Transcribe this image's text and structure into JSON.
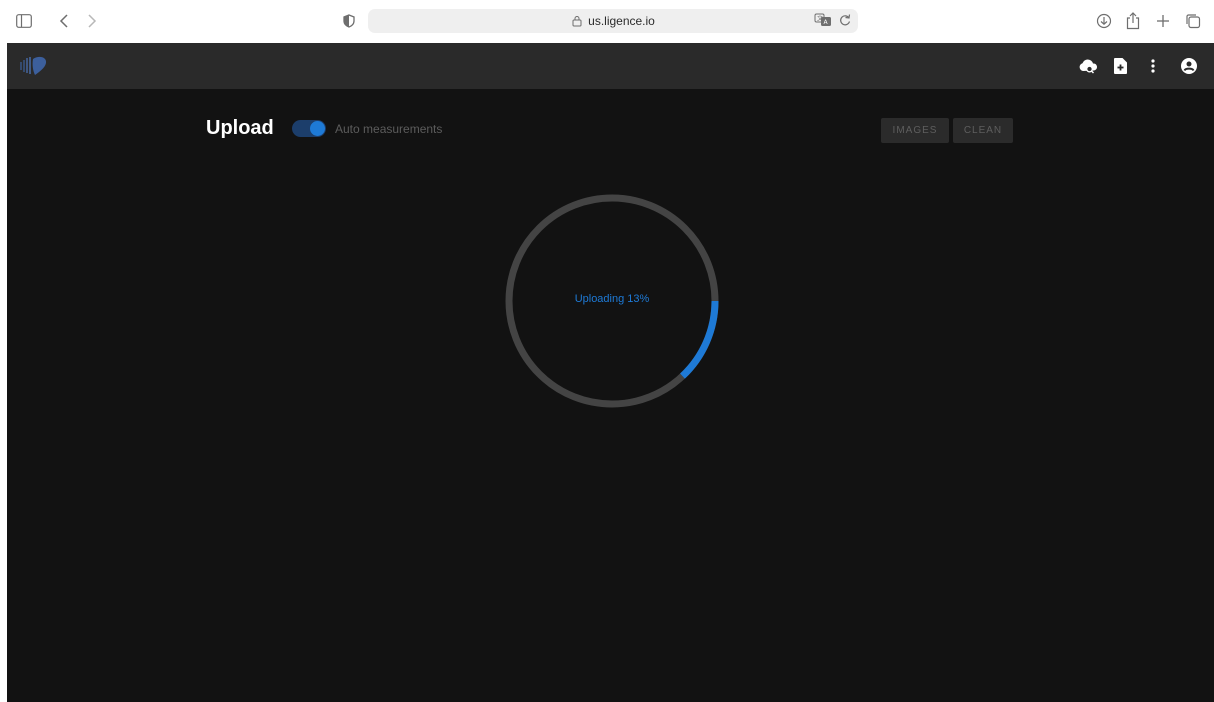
{
  "browser": {
    "url": "us.ligence.io",
    "icons": [
      "sidebar-icon",
      "back-icon",
      "forward-icon",
      "shield-icon",
      "lock-icon",
      "translate-icon",
      "reload-icon",
      "download-icon",
      "share-icon",
      "new-tab-icon",
      "tab-overview-icon"
    ]
  },
  "header": {
    "icons": [
      "cloud-search-icon",
      "file-add-icon",
      "more-vert-icon",
      "account-icon"
    ]
  },
  "main": {
    "title": "Upload",
    "toggle_label": "Auto measurements",
    "toggle_on": true,
    "buttons": {
      "images": "IMAGES",
      "clean": "CLEAN"
    },
    "progress": {
      "percent": 13,
      "text": "Uploading 13%"
    }
  },
  "colors": {
    "accent": "#1e7ad6",
    "background": "#121212",
    "header": "#2a2a2a",
    "track": "#444444"
  }
}
